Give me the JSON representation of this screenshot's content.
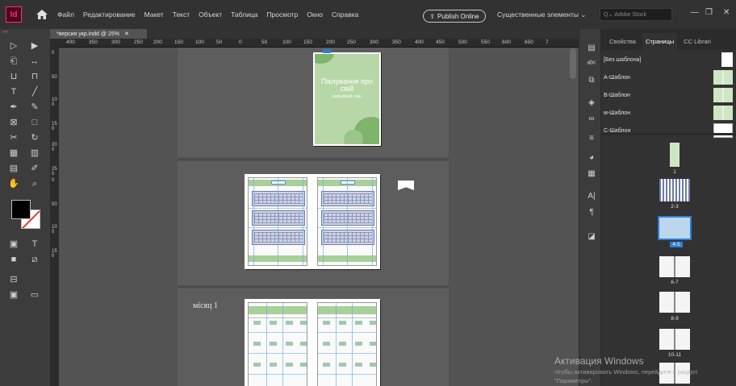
{
  "app": {
    "icon_label": "Id",
    "menu": [
      "Файл",
      "Редактирование",
      "Макет",
      "Текст",
      "Объект",
      "Таблица",
      "Просмотр",
      "Окно",
      "Справка"
    ],
    "publish_label": "Publish Online",
    "workspace_label": "Существенные элементы",
    "stock_placeholder": "Adobe Stock"
  },
  "document": {
    "tab_title": "*версия укр.indd @ 25%",
    "ruler_h": [
      "400",
      "350",
      "300",
      "250",
      "200",
      "150",
      "100",
      "50",
      "0",
      "50",
      "100",
      "150",
      "200",
      "250",
      "300",
      "350",
      "400",
      "450",
      "500",
      "550",
      "600",
      "650",
      "7"
    ],
    "ruler_v": [
      "0",
      "50",
      "100",
      "150",
      "200",
      "250",
      "0",
      "50",
      "100",
      "150"
    ],
    "cover_title": "Піклування про свій",
    "cover_subtitle": "емоційний стан",
    "month_label": "місяц 1"
  },
  "panel": {
    "tabs": [
      "Свойства",
      "Страницы",
      "CC Librari"
    ],
    "masters": [
      "[Без шаблона]",
      "А-Шаблон",
      "В-Шаблон",
      "м-Шаблон",
      "С-Шаблон"
    ],
    "pages": [
      {
        "label": "1",
        "selected": false,
        "master": "А"
      },
      {
        "label": "2-3",
        "selected": false,
        "master": ""
      },
      {
        "label": "4-5",
        "selected": true,
        "master": "м"
      },
      {
        "label": "6-7",
        "selected": false,
        "master": "А"
      },
      {
        "label": "8-9",
        "selected": false,
        "master": "А"
      },
      {
        "label": "10-11",
        "selected": false,
        "master": "А"
      }
    ]
  },
  "watermark": {
    "title": "Активация Windows",
    "line1": "Чтобы активировать Windows, перейдите в раздел",
    "line2": "\"Параметры\"."
  },
  "colors": {
    "accent": "#2a7fd6",
    "cover_green": "#b8d7a8",
    "fill": "#000000",
    "stroke": "#ffffff"
  }
}
